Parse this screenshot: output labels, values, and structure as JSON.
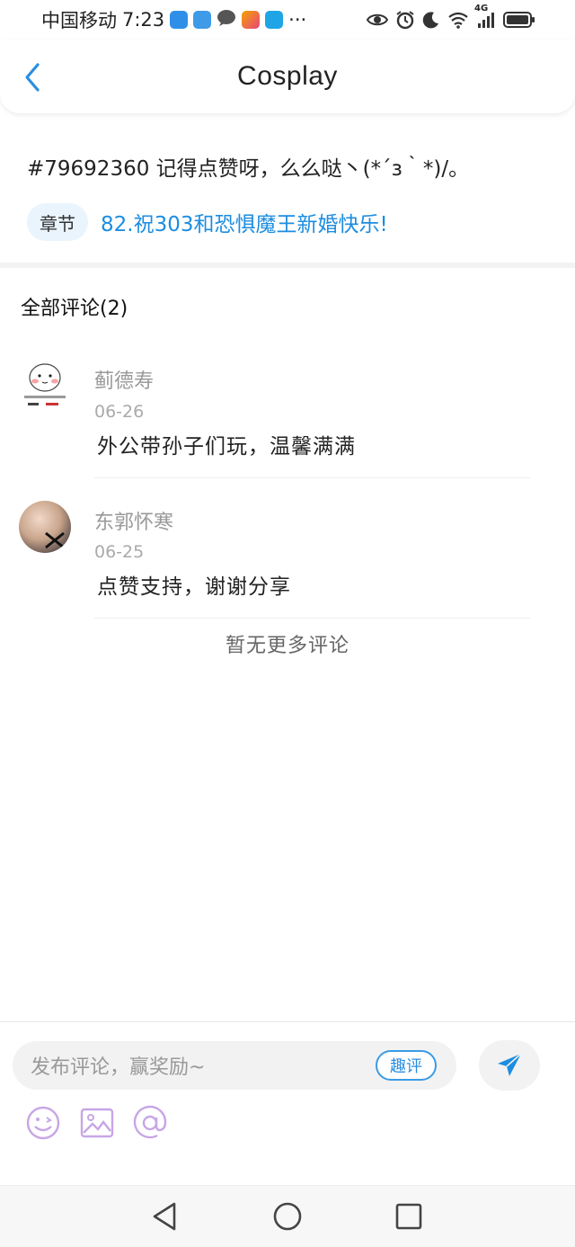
{
  "status_bar": {
    "carrier": "中国移动",
    "time": "7:23",
    "more": "···",
    "network": "4G"
  },
  "header": {
    "title": "Cosplay"
  },
  "post": {
    "text": "#79692360 记得点赞呀，么么哒丶(*´з｀*)/。",
    "chapter_tag": "章节",
    "chapter_link": "82.祝303和恐惧魔王新婚快乐!"
  },
  "comments": {
    "title": "全部评论(2)",
    "items": [
      {
        "name": "蓟德寿",
        "date": "06-26",
        "text": "外公带孙子们玩，温馨满满"
      },
      {
        "name": "东郭怀寒",
        "date": "06-25",
        "text": "点赞支持，谢谢分享"
      }
    ],
    "no_more": "暂无更多评论"
  },
  "input": {
    "placeholder": "发布评论，赢奖励~",
    "fun_button": "趣评"
  },
  "colors": {
    "accent": "#1d8de0",
    "tool_icon": "#c7a6e6"
  }
}
